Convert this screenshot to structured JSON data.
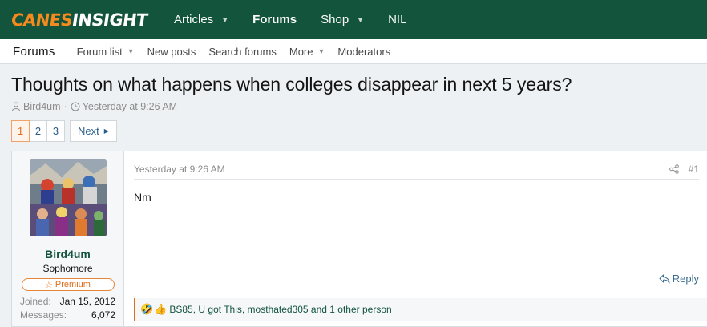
{
  "site": {
    "logo_part1": "CANES",
    "logo_part2": "INSIGHT"
  },
  "topnav": {
    "items": [
      {
        "label": "Articles",
        "has_caret": true,
        "active": false
      },
      {
        "label": "Forums",
        "has_caret": false,
        "active": true
      },
      {
        "label": "Shop",
        "has_caret": true,
        "active": false
      },
      {
        "label": "NIL",
        "has_caret": false,
        "active": false
      }
    ]
  },
  "subnav": {
    "section": "Forums",
    "items": [
      {
        "label": "Forum list",
        "has_caret": true
      },
      {
        "label": "New posts",
        "has_caret": false
      },
      {
        "label": "Search forums",
        "has_caret": false
      },
      {
        "label": "More",
        "has_caret": true
      },
      {
        "label": "Moderators",
        "has_caret": false
      }
    ]
  },
  "thread": {
    "title": "Thoughts on what happens when colleges disappear in next 5 years?",
    "author": "Bird4um",
    "separator": "·",
    "date": "Yesterday at 9:26 AM"
  },
  "pagination": {
    "pages": [
      "1",
      "2",
      "3"
    ],
    "current": "1",
    "next_label": "Next"
  },
  "post": {
    "username": "Bird4um",
    "user_title": "Sophomore",
    "badge": "Premium",
    "stats": [
      {
        "key": "Joined:",
        "value": "Jan 15, 2012"
      },
      {
        "key": "Messages:",
        "value": "6,072"
      }
    ],
    "date": "Yesterday at 9:26 AM",
    "number": "#1",
    "body": "Nm",
    "reply_label": "Reply",
    "reactions_text": "BS85, U got This, mosthated305 and 1 other person"
  },
  "colors": {
    "brand_green": "#13543c",
    "accent_orange": "#e36d1b",
    "link_blue": "#2a5d8a"
  }
}
